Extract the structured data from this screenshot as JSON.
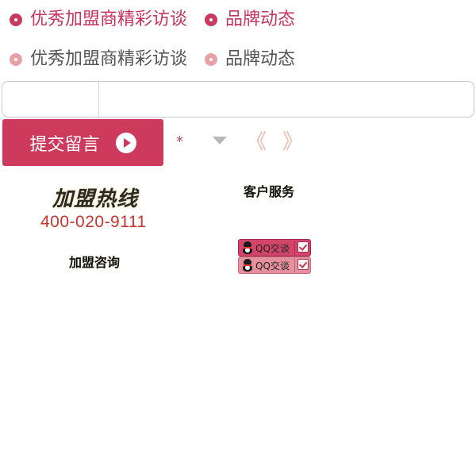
{
  "nav_active": {
    "tab1": "优秀加盟商精彩访谈",
    "tab2": "品牌动态"
  },
  "nav_inactive": {
    "tab1": "优秀加盟商精彩访谈",
    "tab2": "品牌动态"
  },
  "form": {
    "left_input_value": "",
    "right_input_value": "",
    "submit_label": "提交留言",
    "required_mark": "*",
    "prev_label": "《",
    "next_label": "》"
  },
  "hotline": {
    "title": "加盟热线",
    "number": "400-020-9111",
    "consult_label": "加盟咨询"
  },
  "service": {
    "title": "客户服务",
    "qq_buttons": [
      "QQ交谈",
      "QQ交谈"
    ]
  },
  "colors": {
    "accent": "#c8345c",
    "inactive_ring": "#e9a1a8",
    "hotline_number": "#c8342e"
  },
  "icons": {
    "ring": "ring-icon",
    "play": "play-icon",
    "dropdown": "triangle-down-icon",
    "qq": "qq-penguin-icon",
    "check": "check-icon"
  }
}
